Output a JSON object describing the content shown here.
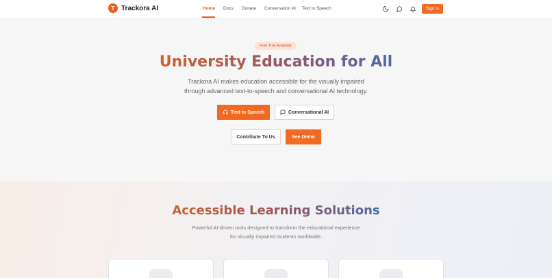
{
  "brand": {
    "logo_letter": "T",
    "name": "Trackora AI"
  },
  "nav": {
    "items": [
      {
        "label": "Home",
        "active": true
      },
      {
        "label": "Docs"
      },
      {
        "label": "Donate"
      },
      {
        "label": "Conversation AI"
      },
      {
        "label": "Text to Speech"
      }
    ]
  },
  "header_actions": {
    "icons": [
      "moon-icon",
      "chat-bubble-icon",
      "bell-icon"
    ],
    "sign_in_label": "Sign In"
  },
  "hero": {
    "badge": "Free Trial Available",
    "title": "University Education for All",
    "subtitle_line1": "Trackora AI makes education accessible for the visually impaired",
    "subtitle_line2": "through advanced text-to-speech and conversational AI technology.",
    "buttons": {
      "text_to_speech": "Text to Speech",
      "conversational_ai": "Conversational AI",
      "contribute": "Contribute To Us",
      "see_demo": "See Demo"
    }
  },
  "solutions": {
    "title": "Accessible Learning Solutions",
    "subtitle_line1": "Powerful AI-driven tools designed to transform the educational experience",
    "subtitle_line2": "for visually impaired students worldwide.",
    "card_icons": [
      "target-icon",
      "document-icon",
      "book-icon"
    ]
  },
  "colors": {
    "accent": "#f26a21",
    "title_gradient": [
      "#d0622c",
      "#9a5561",
      "#4a6aa8"
    ]
  }
}
